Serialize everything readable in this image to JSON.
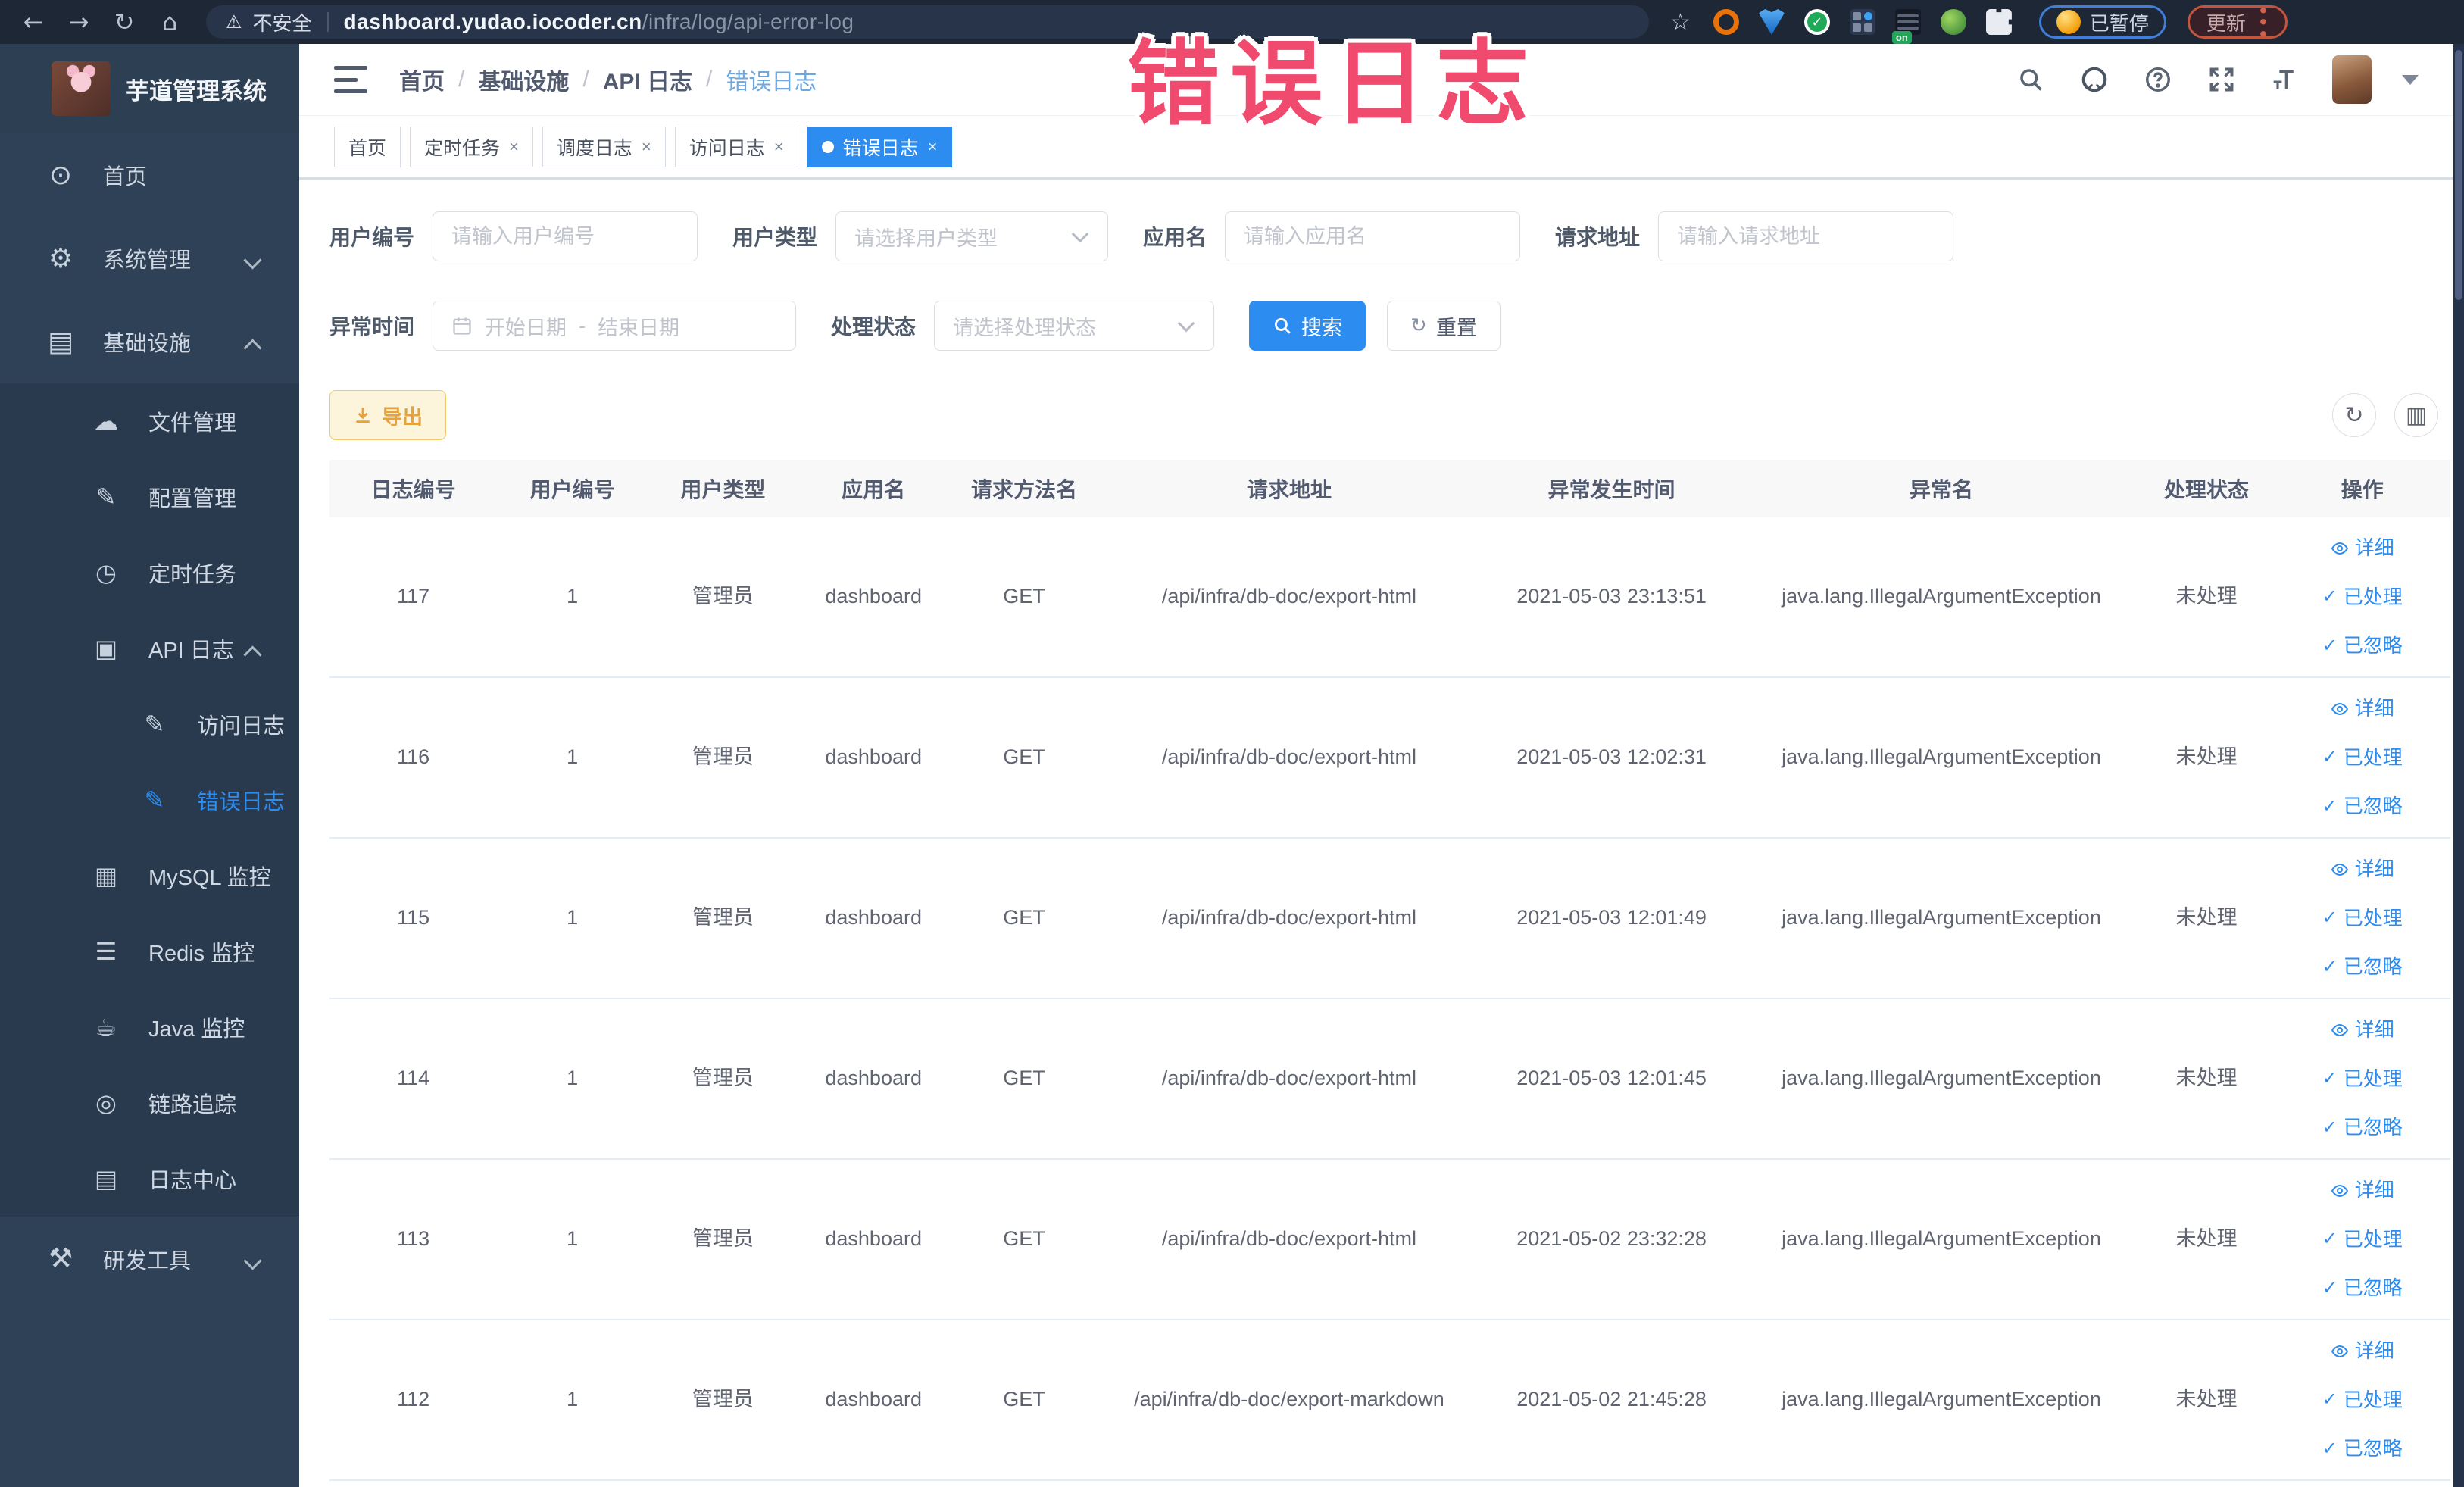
{
  "colors": {
    "accent": "#2d8cf0",
    "warning": "#e6a23c",
    "sidebar_bg": "#2f4156",
    "annotation_pink": "#f04a6e",
    "browser_bar": "#1d2736"
  },
  "browser": {
    "security_label": "不安全",
    "url_domain": "dashboard.yudao.iocoder.cn",
    "url_path": "/infra/log/api-error-log",
    "paused_badge": "已暂停",
    "update_button": "更新",
    "on_badge": "on"
  },
  "annotation": {
    "text": "错误日志"
  },
  "sidebar": {
    "logo_title": "芋道管理系统",
    "items": [
      {
        "label": "首页",
        "glyph": "⊙"
      },
      {
        "label": "系统管理",
        "glyph": "⚙"
      },
      {
        "label": "基础设施",
        "glyph": "▤"
      },
      {
        "label": "文件管理",
        "glyph": "☁"
      },
      {
        "label": "配置管理",
        "glyph": "✎"
      },
      {
        "label": "定时任务",
        "glyph": "◷"
      },
      {
        "label": "API 日志",
        "glyph": "▣"
      },
      {
        "label": "访问日志",
        "glyph": "✎"
      },
      {
        "label": "错误日志",
        "glyph": "✎"
      },
      {
        "label": "MySQL 监控",
        "glyph": "▦"
      },
      {
        "label": "Redis 监控",
        "glyph": "☰"
      },
      {
        "label": "Java 监控",
        "glyph": "☕"
      },
      {
        "label": "链路追踪",
        "glyph": "◎"
      },
      {
        "label": "日志中心",
        "glyph": "▤"
      },
      {
        "label": "研发工具",
        "glyph": "⚒"
      }
    ]
  },
  "breadcrumb": {
    "sep": "/",
    "items": [
      "首页",
      "基础设施",
      "API 日志",
      "错误日志"
    ]
  },
  "tabs": [
    {
      "label": "首页"
    },
    {
      "label": "定时任务",
      "close": "×"
    },
    {
      "label": "调度日志",
      "close": "×"
    },
    {
      "label": "访问日志",
      "close": "×"
    },
    {
      "label": "错误日志",
      "close": "×"
    }
  ],
  "filters": {
    "user_id": {
      "label": "用户编号",
      "placeholder": "请输入用户编号"
    },
    "user_type": {
      "label": "用户类型",
      "placeholder": "请选择用户类型"
    },
    "app_name": {
      "label": "应用名",
      "placeholder": "请输入应用名"
    },
    "request_url": {
      "label": "请求地址",
      "placeholder": "请输入请求地址"
    },
    "exception_time": {
      "label": "异常时间",
      "start_placeholder": "开始日期",
      "separator": "-",
      "end_placeholder": "结束日期"
    },
    "process_status": {
      "label": "处理状态",
      "placeholder": "请选择处理状态"
    },
    "search_label": "搜索",
    "reset_label": "重置"
  },
  "toolbar": {
    "export_label": "导出"
  },
  "table": {
    "headers": [
      "日志编号",
      "用户编号",
      "用户类型",
      "应用名",
      "请求方法名",
      "请求地址",
      "异常发生时间",
      "异常名",
      "处理状态",
      "操作"
    ],
    "actions": {
      "detail": "详细",
      "processed": "已处理",
      "ignored": "已忽略",
      "check_glyph": "✓"
    },
    "rows": [
      {
        "id": "117",
        "user_id": "1",
        "user_type": "管理员",
        "app": "dashboard",
        "method": "GET",
        "url": "/api/infra/db-doc/export-html",
        "time": "2021-05-03 23:13:51",
        "exception": "java.lang.IllegalArgumentException",
        "status": "未处理"
      },
      {
        "id": "116",
        "user_id": "1",
        "user_type": "管理员",
        "app": "dashboard",
        "method": "GET",
        "url": "/api/infra/db-doc/export-html",
        "time": "2021-05-03 12:02:31",
        "exception": "java.lang.IllegalArgumentException",
        "status": "未处理"
      },
      {
        "id": "115",
        "user_id": "1",
        "user_type": "管理员",
        "app": "dashboard",
        "method": "GET",
        "url": "/api/infra/db-doc/export-html",
        "time": "2021-05-03 12:01:49",
        "exception": "java.lang.IllegalArgumentException",
        "status": "未处理"
      },
      {
        "id": "114",
        "user_id": "1",
        "user_type": "管理员",
        "app": "dashboard",
        "method": "GET",
        "url": "/api/infra/db-doc/export-html",
        "time": "2021-05-03 12:01:45",
        "exception": "java.lang.IllegalArgumentException",
        "status": "未处理"
      },
      {
        "id": "113",
        "user_id": "1",
        "user_type": "管理员",
        "app": "dashboard",
        "method": "GET",
        "url": "/api/infra/db-doc/export-html",
        "time": "2021-05-02 23:32:28",
        "exception": "java.lang.IllegalArgumentException",
        "status": "未处理"
      },
      {
        "id": "112",
        "user_id": "1",
        "user_type": "管理员",
        "app": "dashboard",
        "method": "GET",
        "url": "/api/infra/db-doc/export-markdown",
        "time": "2021-05-02 21:45:28",
        "exception": "java.lang.IllegalArgumentException",
        "status": "未处理"
      }
    ]
  }
}
